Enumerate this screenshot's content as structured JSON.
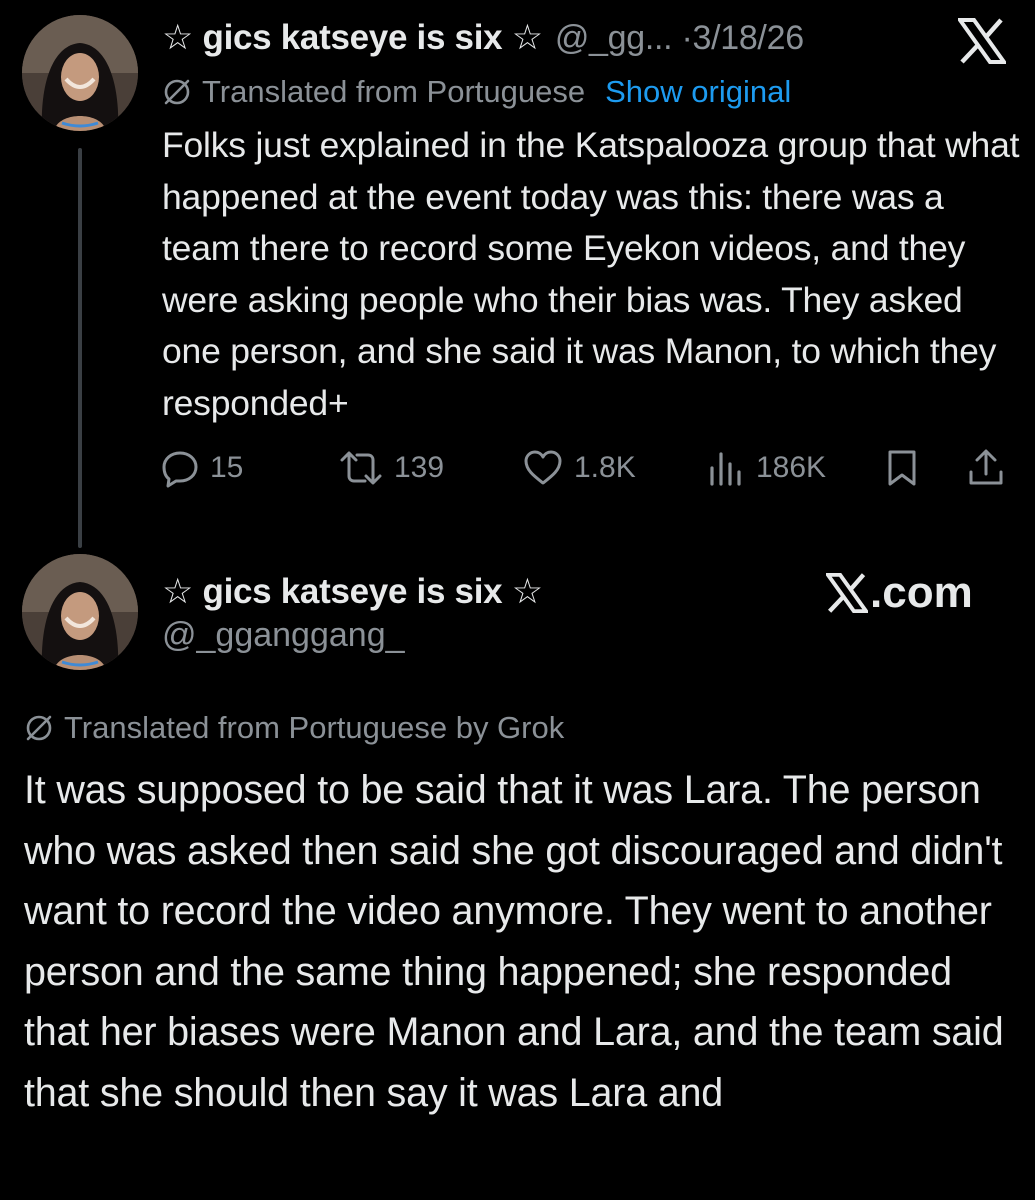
{
  "tweet1": {
    "display_name": "☆ gics katseye is six ☆",
    "handle_date": "@_gg... ·3/18/26",
    "translated_label": "Translated from Portuguese",
    "show_original": "Show original",
    "body": "Folks just explained in the Katspalooza group that what happened at the event today was this: there was a team there to record some Eyekon videos, and they were asking people who their bias was. They asked one person, and she said it was Manon, to which they responded+",
    "counts": {
      "replies": "15",
      "reposts": "139",
      "likes": "1.8K",
      "views": "186K"
    }
  },
  "tweet2": {
    "display_name": "☆ gics katseye is six ☆",
    "handle": "@_gganggang_",
    "source_label": ".com",
    "translated_label": "Translated from Portuguese by Grok",
    "body": "It was supposed to be said that it was Lara. The person who was asked then said she got discouraged and didn't want to record the video anymore. They went to another person and the same thing happened; she responded that her biases were Manon and Lara, and the team said that she should then say it was Lara and"
  },
  "colors": {
    "background": "#000000",
    "text": "#e7e9ea",
    "secondary": "#8b9197",
    "link": "#1d9bf0"
  },
  "icons": [
    "x-logo-icon",
    "globe-slash-icon",
    "reply-icon",
    "repost-icon",
    "like-icon",
    "views-icon",
    "bookmark-icon",
    "share-icon"
  ]
}
